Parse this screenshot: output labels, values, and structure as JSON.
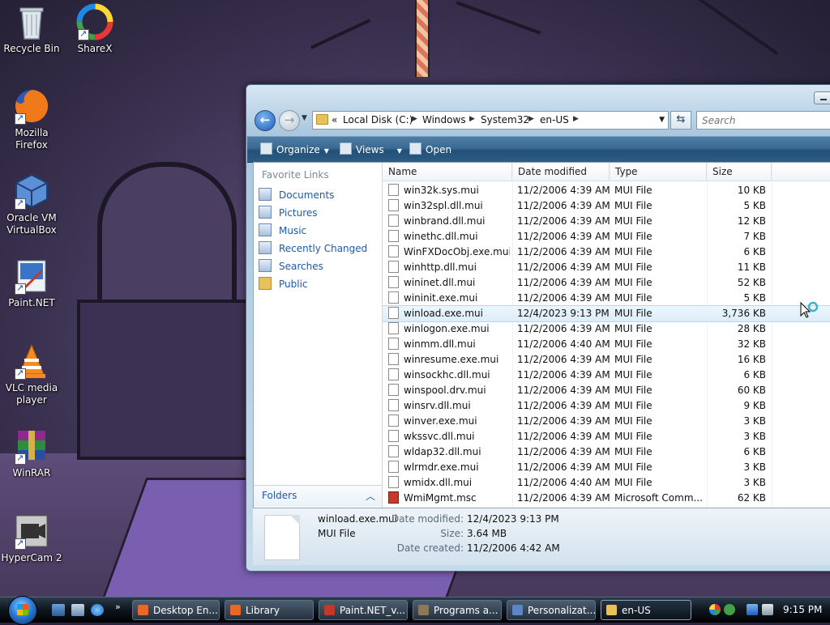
{
  "desktop": {
    "icons": [
      {
        "label": "Recycle Bin",
        "icon": "recycle-bin-icon"
      },
      {
        "label": "ShareX",
        "icon": "sharex-icon"
      },
      {
        "label": "Mozilla Firefox",
        "icon": "firefox-icon"
      },
      {
        "label": "Oracle VM VirtualBox",
        "icon": "virtualbox-icon"
      },
      {
        "label": "Paint.NET",
        "icon": "paintnet-icon"
      },
      {
        "label": "VLC media player",
        "icon": "vlc-icon"
      },
      {
        "label": "WinRAR",
        "icon": "winrar-icon"
      },
      {
        "label": "HyperCam 2",
        "icon": "hypercam-icon"
      }
    ]
  },
  "explorer": {
    "breadcrumb": {
      "overflow": "«",
      "parts": [
        "Local Disk (C:)",
        "Windows",
        "System32",
        "en-US"
      ]
    },
    "search": {
      "placeholder": "Search"
    },
    "toolbar": {
      "organize": "Organize",
      "views": "Views",
      "open": "Open"
    },
    "nav": {
      "favorites_title": "Favorite Links",
      "links": [
        "Documents",
        "Pictures",
        "Music",
        "Recently Changed",
        "Searches",
        "Public"
      ],
      "folders_label": "Folders"
    },
    "columns": {
      "name": "Name",
      "date": "Date modified",
      "type": "Type",
      "size": "Size"
    },
    "files": [
      {
        "name": "win32k.sys.mui",
        "date": "11/2/2006 4:39 AM",
        "type": "MUI File",
        "size": "10 KB"
      },
      {
        "name": "win32spl.dll.mui",
        "date": "11/2/2006 4:39 AM",
        "type": "MUI File",
        "size": "5 KB"
      },
      {
        "name": "winbrand.dll.mui",
        "date": "11/2/2006 4:39 AM",
        "type": "MUI File",
        "size": "12 KB"
      },
      {
        "name": "winethc.dll.mui",
        "date": "11/2/2006 4:39 AM",
        "type": "MUI File",
        "size": "7 KB"
      },
      {
        "name": "WinFXDocObj.exe.mui",
        "date": "11/2/2006 4:39 AM",
        "type": "MUI File",
        "size": "6 KB"
      },
      {
        "name": "winhttp.dll.mui",
        "date": "11/2/2006 4:39 AM",
        "type": "MUI File",
        "size": "11 KB"
      },
      {
        "name": "wininet.dll.mui",
        "date": "11/2/2006 4:39 AM",
        "type": "MUI File",
        "size": "52 KB"
      },
      {
        "name": "wininit.exe.mui",
        "date": "11/2/2006 4:39 AM",
        "type": "MUI File",
        "size": "5 KB"
      },
      {
        "name": "winload.exe.mui",
        "date": "12/4/2023 9:13 PM",
        "type": "MUI File",
        "size": "3,736 KB",
        "selected": true
      },
      {
        "name": "winlogon.exe.mui",
        "date": "11/2/2006 4:39 AM",
        "type": "MUI File",
        "size": "28 KB"
      },
      {
        "name": "winmm.dll.mui",
        "date": "11/2/2006 4:40 AM",
        "type": "MUI File",
        "size": "32 KB"
      },
      {
        "name": "winresume.exe.mui",
        "date": "11/2/2006 4:39 AM",
        "type": "MUI File",
        "size": "16 KB"
      },
      {
        "name": "winsockhc.dll.mui",
        "date": "11/2/2006 4:39 AM",
        "type": "MUI File",
        "size": "6 KB"
      },
      {
        "name": "winspool.drv.mui",
        "date": "11/2/2006 4:39 AM",
        "type": "MUI File",
        "size": "60 KB"
      },
      {
        "name": "winsrv.dll.mui",
        "date": "11/2/2006 4:39 AM",
        "type": "MUI File",
        "size": "9 KB"
      },
      {
        "name": "winver.exe.mui",
        "date": "11/2/2006 4:39 AM",
        "type": "MUI File",
        "size": "3 KB"
      },
      {
        "name": "wkssvc.dll.mui",
        "date": "11/2/2006 4:39 AM",
        "type": "MUI File",
        "size": "3 KB"
      },
      {
        "name": "wldap32.dll.mui",
        "date": "11/2/2006 4:39 AM",
        "type": "MUI File",
        "size": "6 KB"
      },
      {
        "name": "wlrmdr.exe.mui",
        "date": "11/2/2006 4:39 AM",
        "type": "MUI File",
        "size": "3 KB"
      },
      {
        "name": "wmidx.dll.mui",
        "date": "11/2/2006 4:40 AM",
        "type": "MUI File",
        "size": "3 KB"
      },
      {
        "name": "WmiMgmt.msc",
        "date": "11/2/2006 4:39 AM",
        "type": "Microsoft Comm...",
        "size": "62 KB",
        "icon": "msc"
      }
    ],
    "details": {
      "name": "winload.exe.mui",
      "type": "MUI File",
      "modified_label": "Date modified:",
      "modified": "12/4/2023 9:13 PM",
      "size_label": "Size:",
      "size": "3.64 MB",
      "created_label": "Date created:",
      "created": "11/2/2006 4:42 AM"
    }
  },
  "taskbar": {
    "tasks": [
      {
        "label": "Desktop En...",
        "color": "#e8672a"
      },
      {
        "label": "Library",
        "color": "#e8672a"
      },
      {
        "label": "Paint.NET_v...",
        "color": "#c0392b"
      },
      {
        "label": "Programs a...",
        "color": "#8a7a5a"
      },
      {
        "label": "Personalizat...",
        "color": "#5a86c4"
      },
      {
        "label": "en-US",
        "color": "#e8c15c",
        "active": true
      }
    ],
    "clock": "9:15 PM"
  }
}
